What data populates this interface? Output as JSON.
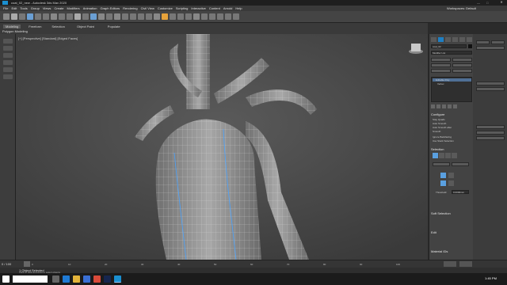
{
  "app": {
    "title": "coat_02_new - Autodesk 3ds Max 2020"
  },
  "menu": [
    "File",
    "Edit",
    "Tools",
    "Group",
    "Views",
    "Create",
    "Modifiers",
    "Animation",
    "Graph Editors",
    "Rendering",
    "Civil View",
    "Customize",
    "Scripting",
    "Interactive",
    "Content",
    "Arnold",
    "Help"
  ],
  "workspace": "Workspaces: Default",
  "ribbon": {
    "tabs": [
      "Modeling",
      "Freeform",
      "Selection",
      "Object Paint",
      "Populate"
    ],
    "active_tab": 0,
    "sub_label": "Polygon Modeling"
  },
  "viewport": {
    "label": "[+] [Perspective] [Standard] [Edged Faces]"
  },
  "right_panel": {
    "object_name": "coat_02",
    "modifier_list_label": "Modifier List",
    "stack_items": [
      "Editable Poly",
      "Vertex"
    ],
    "sections": {
      "configure": "Configure",
      "selection": "Selection",
      "soft_selection": "Soft Selection",
      "edit": "Edit",
      "material_ids": "Material IDs"
    },
    "options": [
      "Stay Quads",
      "Auto Smooth",
      "Auto Smooth after",
      "Smooth",
      "Ignore Backfacing",
      "Use Stack Selection"
    ],
    "threshold_label": "Threshold:",
    "threshold_value": "0.0000mm"
  },
  "timeline": {
    "frame_display": "0 / 100",
    "ticks": [
      "0",
      "10",
      "20",
      "30",
      "40",
      "50",
      "60",
      "70",
      "80",
      "90",
      "100"
    ]
  },
  "status": {
    "text": "1 Object Selected",
    "prompt": "Click or click-and-drag to select objects"
  },
  "taskbar": {
    "time": "1:45 PM",
    "date": ""
  }
}
